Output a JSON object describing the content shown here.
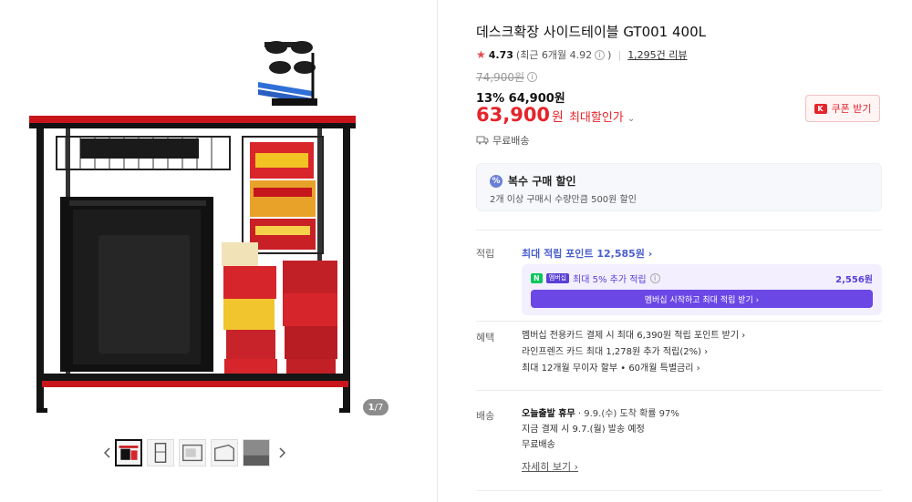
{
  "product": {
    "title": "데스크확장 사이드테이블 GT001 400L",
    "rating": "4.73",
    "recent_rating": "(최근 6개월 4.92",
    "review_count": "1,295건 리뷰",
    "original_price": "74,900원",
    "discount_line": "13% 64,900원",
    "sale_price": "63,900",
    "sale_unit": "원",
    "max_discount_label": "최대할인가",
    "coupon_label": "쿠폰 받기",
    "shipping": "무료배송"
  },
  "gallery": {
    "page_current": "1",
    "page_total": "/7"
  },
  "multi_buy": {
    "title": "복수 구매 할인",
    "desc": "2개 이상 구매시 수량만큼 500원 할인"
  },
  "points": {
    "label": "적립",
    "max_points": "최대 적립 포인트 12,585원 ›",
    "member_text": "최대 5% 추가 적립",
    "member_badge": "멤버십",
    "member_amount": "2,556원",
    "member_button": "멤버십 시작하고 최대 적립 받기 ›"
  },
  "benefits": {
    "label": "혜택",
    "items": [
      "멤버십 전용카드 결제 시 최대 6,390원 적립 포인트 받기 ›",
      "라인프렌즈 카드 최대 1,278원 추가 적립(2%) ›",
      "최대 12개월 무이자 할부 • 60개월 특별금리 ›"
    ]
  },
  "delivery": {
    "label": "배송",
    "holiday": "오늘출발 휴무",
    "arrival": "9.9.(수) 도착 확률 97%",
    "ship_note": "지금 결제 시 9.7.(월) 발송 예정",
    "free": "무료배송",
    "detail_link": "자세히 보기 ›"
  },
  "colors": {
    "accent_red": "#e5242b",
    "point_blue": "#4a5ecf",
    "membership_purple": "#6b47e6"
  }
}
